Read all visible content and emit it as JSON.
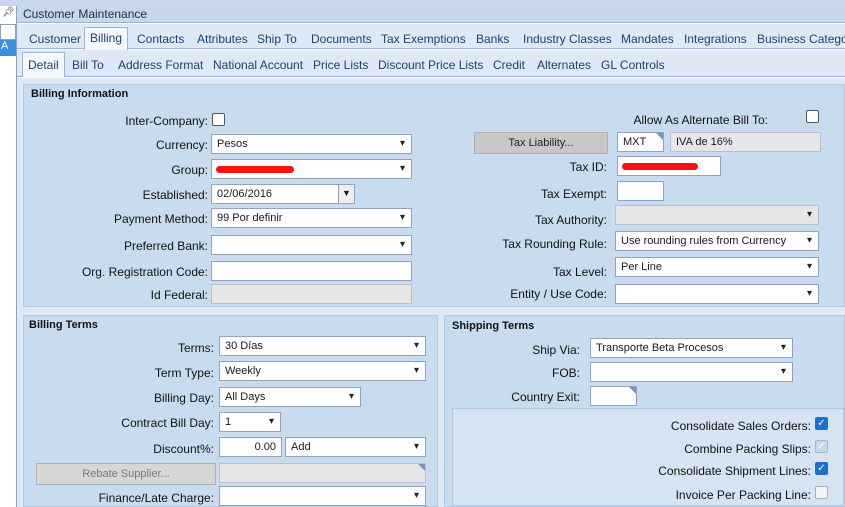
{
  "window": {
    "title": "Customer Maintenance",
    "pin_icon": "pin-icon"
  },
  "left_pane": {
    "selected_text": "A"
  },
  "main_tabs": [
    "Customer",
    "Billing",
    "Contacts",
    "Attributes",
    "Ship To",
    "Documents",
    "Tax Exemptions",
    "Banks",
    "Industry Classes",
    "Mandates",
    "Integrations",
    "Business Catego"
  ],
  "sub_tabs": [
    "Detail",
    "Bill To",
    "Address Format",
    "National Account",
    "Price Lists",
    "Discount Price Lists",
    "Credit",
    "Alternates",
    "GL Controls"
  ],
  "billing_info": {
    "title": "Billing Information",
    "inter_company_label": "Inter-Company:",
    "inter_company_checked": false,
    "currency_label": "Currency:",
    "currency_value": "Pesos",
    "group_label": "Group:",
    "established_label": "Established:",
    "established_value": "02/06/2016",
    "payment_method_label": "Payment Method:",
    "payment_method_value": "99 Por definir",
    "preferred_bank_label": "Preferred Bank:",
    "preferred_bank_value": "",
    "org_reg_label": "Org. Registration Code:",
    "org_reg_value": "",
    "id_federal_label": "Id Federal:",
    "id_federal_value": "",
    "allow_alt_bill_label": "Allow As Alternate Bill To:",
    "allow_alt_bill_checked": false,
    "tax_liability_button": "Tax Liability...",
    "tax_liability_code": "MXT",
    "tax_liability_desc": "IVA de 16%",
    "tax_id_label": "Tax ID:",
    "tax_exempt_label": "Tax Exempt:",
    "tax_exempt_value": "",
    "tax_authority_label": "Tax Authority:",
    "tax_authority_value": "",
    "tax_rounding_label": "Tax Rounding Rule:",
    "tax_rounding_value": "Use rounding rules from Currency",
    "tax_level_label": "Tax Level:",
    "tax_level_value": "Per Line",
    "entity_use_label": "Entity / Use Code:",
    "entity_use_value": ""
  },
  "billing_terms": {
    "title": "Billing Terms",
    "terms_label": "Terms:",
    "terms_value": "30 Días",
    "term_type_label": "Term Type:",
    "term_type_value": "Weekly",
    "billing_day_label": "Billing Day:",
    "billing_day_value": "All Days",
    "contract_bill_day_label": "Contract Bill Day:",
    "contract_bill_day_value": "1",
    "discount_label": "Discount%:",
    "discount_value": "0.00",
    "discount_mode": "Add",
    "rebate_supplier_button": "Rebate Supplier...",
    "finance_late_label": "Finance/Late Charge:",
    "finance_late_value": ""
  },
  "shipping_terms": {
    "title": "Shipping Terms",
    "ship_via_label": "Ship Via:",
    "ship_via_value": "Transporte Beta Procesos",
    "fob_label": "FOB:",
    "fob_value": "",
    "country_exit_label": "Country Exit:",
    "country_exit_value": "",
    "consolidate_sales_label": "Consolidate Sales Orders:",
    "consolidate_sales_checked": true,
    "combine_packing_label": "Combine Packing Slips:",
    "combine_packing_checked": true,
    "consolidate_shipment_label": "Consolidate Shipment Lines:",
    "consolidate_shipment_checked": true,
    "invoice_per_packing_label": "Invoice Per Packing Line:",
    "invoice_per_packing_checked": false
  },
  "colors": {
    "accent": "#1f6fd0",
    "panel": "#c9dbef",
    "redaction": "#ff1010"
  }
}
